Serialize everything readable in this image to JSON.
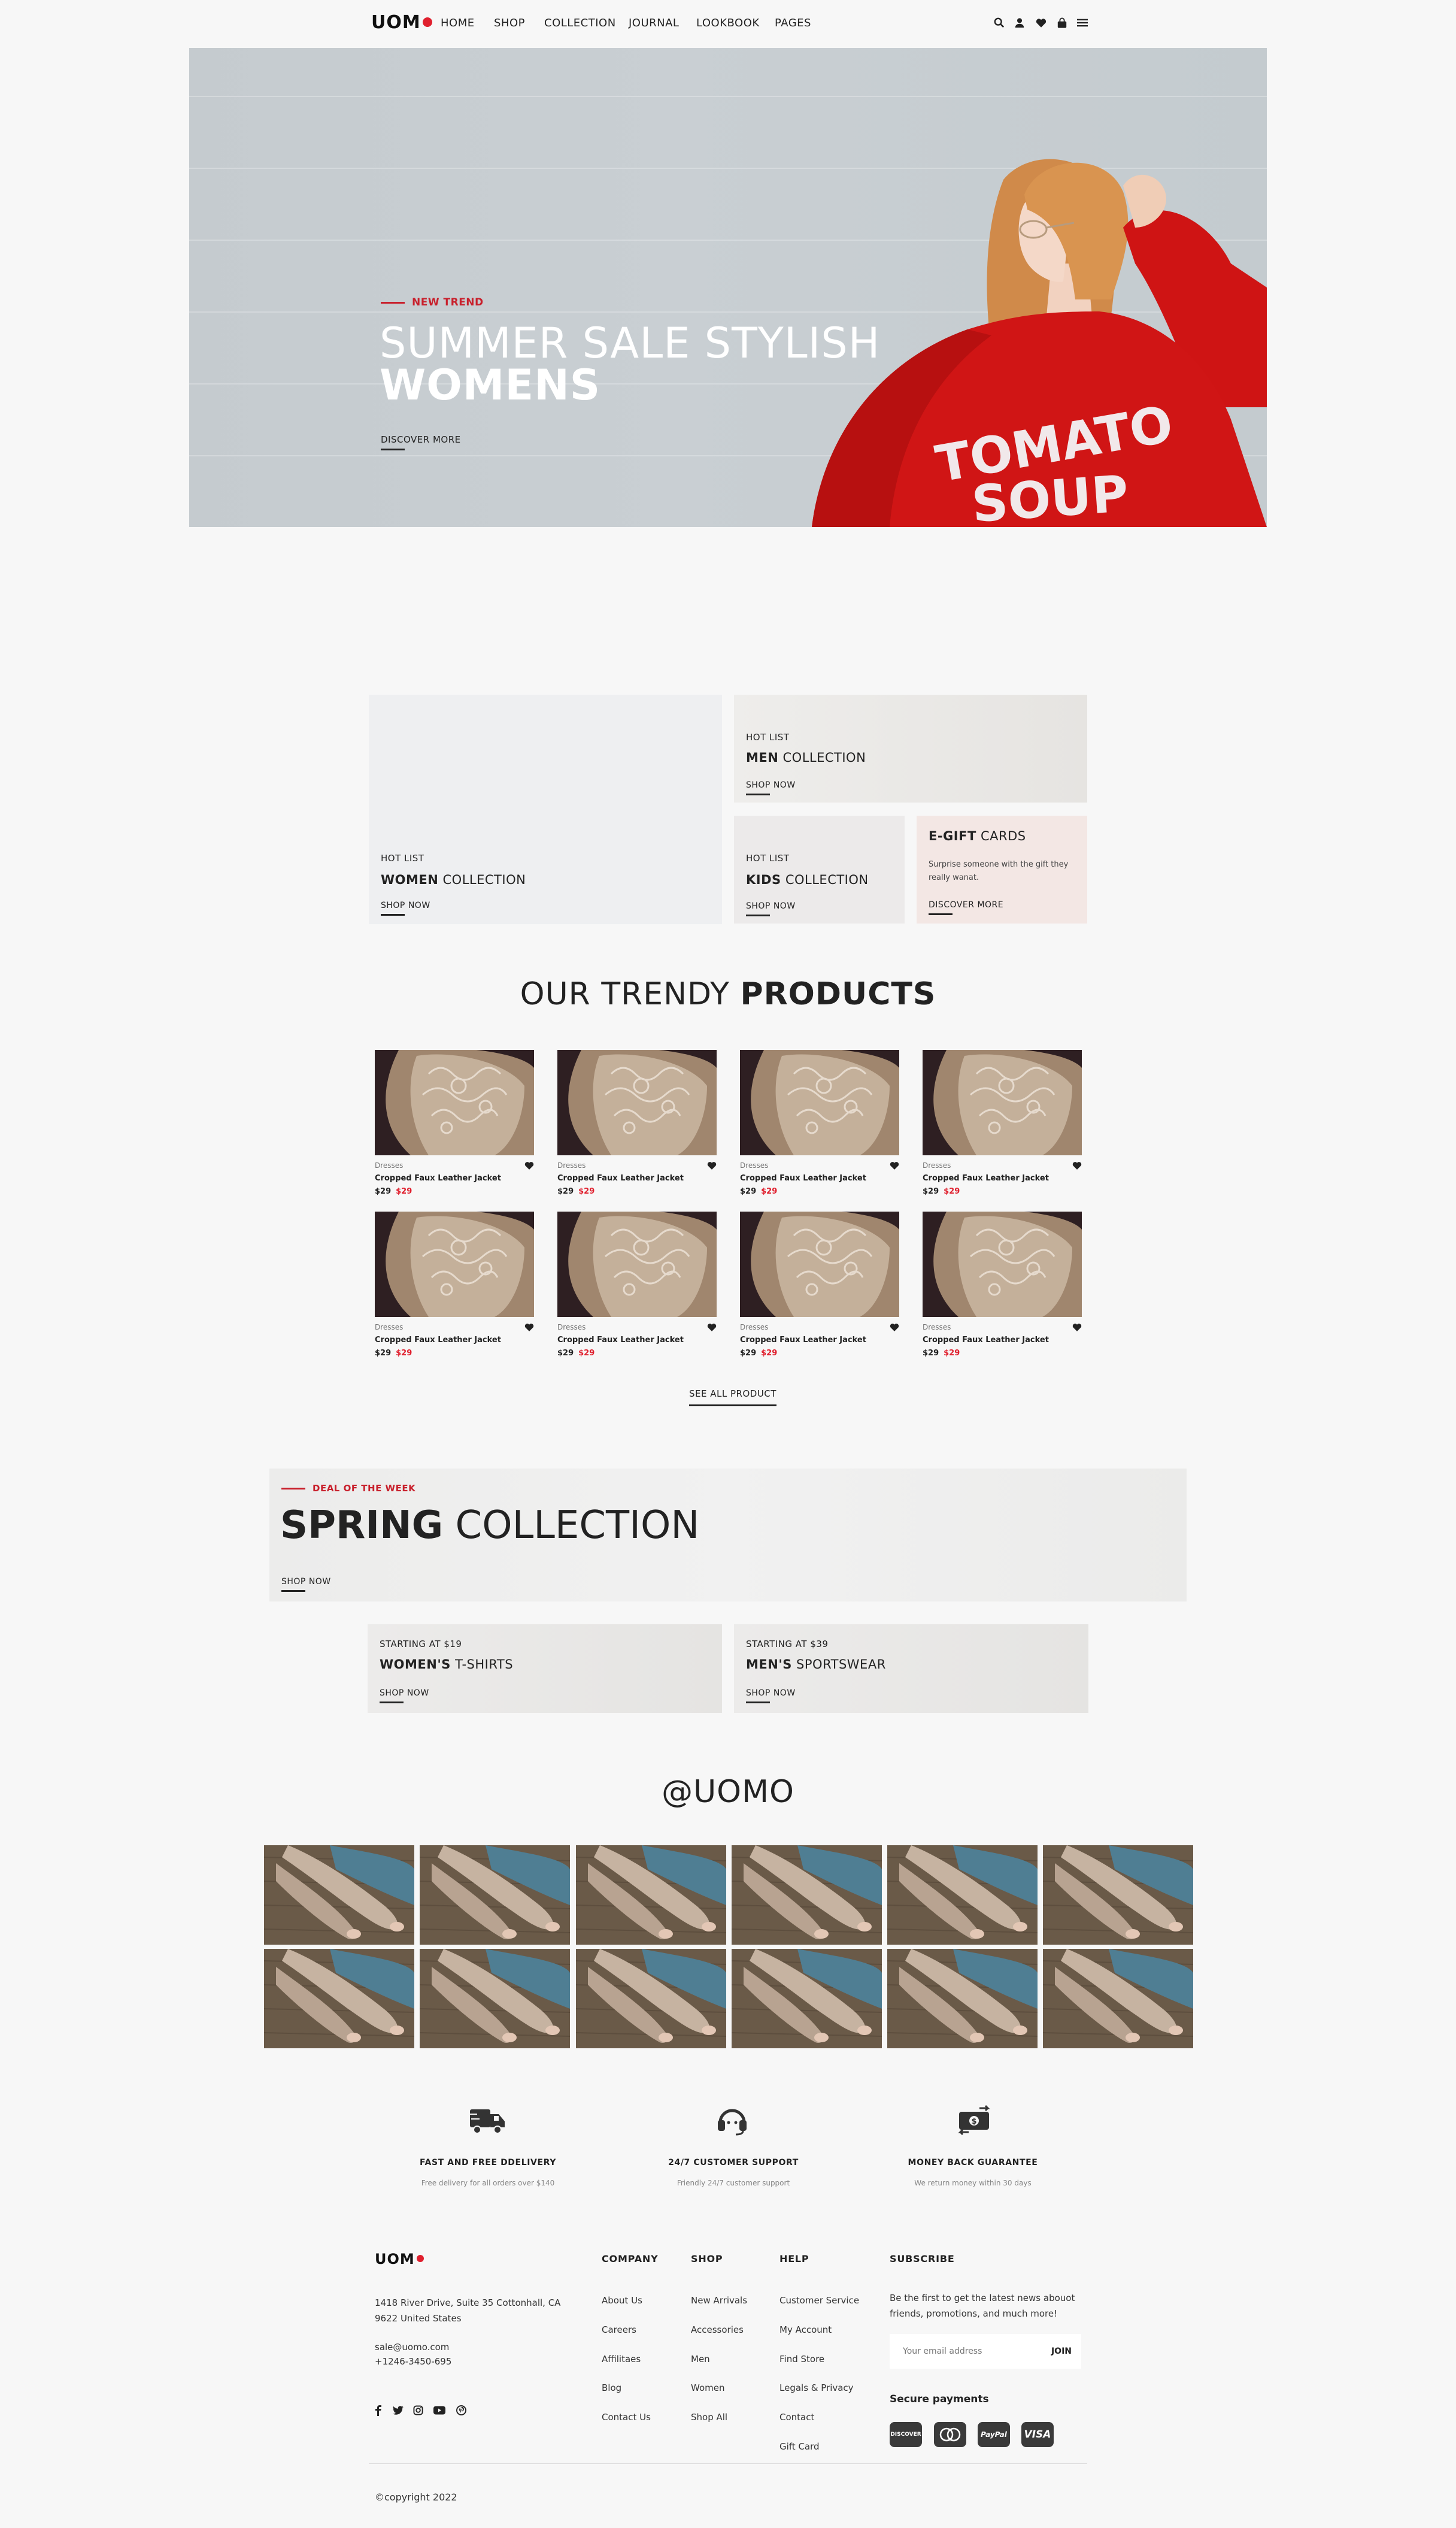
{
  "header": {
    "logo": "UOM",
    "nav": [
      "HOME",
      "SHOP",
      "COLLECTION",
      "JOURNAL",
      "LOOKBOOK",
      "PAGES"
    ],
    "icons": [
      "search-icon",
      "user-icon",
      "heart-icon",
      "cart-icon",
      "menu-icon"
    ]
  },
  "hero": {
    "tag": "NEW TREND",
    "title_light": "SUMMER SALE STYLISH",
    "title_bold": "WOMENS",
    "cta": "DISCOVER MORE",
    "shirt_text_1": "TOMATO",
    "shirt_text_2": "SOUP"
  },
  "collections": {
    "women": {
      "tag": "HOT LIST",
      "bold": "WOMEN",
      "rest": " COLLECTION",
      "cta": "SHOP NOW"
    },
    "men": {
      "tag": "HOT LIST",
      "bold": "MEN",
      "rest": " COLLECTION",
      "cta": "SHOP NOW"
    },
    "kids": {
      "tag": "HOT LIST",
      "bold": "KIDS",
      "rest": " COLLECTION",
      "cta": "SHOP NOW"
    },
    "gift": {
      "bold": "E-GIFT",
      "rest": " CARDS",
      "desc1": "Surprise someone with the gift they",
      "desc2": "really wanat.",
      "cta": "DISCOVER MORE"
    }
  },
  "products": {
    "title_light": "OUR TRENDY ",
    "title_bold": "PRODUCTS",
    "items": [
      {
        "category": "Dresses",
        "name": "Cropped Faux Leather Jacket",
        "price": "$29",
        "sale": "$29"
      },
      {
        "category": "Dresses",
        "name": "Cropped Faux Leather Jacket",
        "price": "$29",
        "sale": "$29"
      },
      {
        "category": "Dresses",
        "name": "Cropped Faux Leather Jacket",
        "price": "$29",
        "sale": "$29"
      },
      {
        "category": "Dresses",
        "name": "Cropped Faux Leather Jacket",
        "price": "$29",
        "sale": "$29"
      },
      {
        "category": "Dresses",
        "name": "Cropped Faux Leather Jacket",
        "price": "$29",
        "sale": "$29"
      },
      {
        "category": "Dresses",
        "name": "Cropped Faux Leather Jacket",
        "price": "$29",
        "sale": "$29"
      },
      {
        "category": "Dresses",
        "name": "Cropped Faux Leather Jacket",
        "price": "$29",
        "sale": "$29"
      },
      {
        "category": "Dresses",
        "name": "Cropped Faux Leather Jacket",
        "price": "$29",
        "sale": "$29"
      }
    ],
    "see_all": "SEE ALL PRODUCT"
  },
  "deal": {
    "tag": "DEAL OF THE WEEK",
    "title_bold": "SPRING",
    "title_light": " COLLECTION",
    "cta": "SHOP NOW"
  },
  "promo": {
    "women": {
      "tag": "STARTING AT $19",
      "bold": "WOMEN'S",
      "rest": " T-SHIRTS",
      "cta": "SHOP NOW"
    },
    "men": {
      "tag": "STARTING AT $39",
      "bold": "MEN'S",
      "rest": " SPORTSWEAR",
      "cta": "SHOP NOW"
    }
  },
  "instagram": {
    "title": "@UOMO"
  },
  "features": [
    {
      "icon": "truck-icon",
      "title": "FAST AND FREE DDELIVERY",
      "sub": "Free delivery for all orders over $140"
    },
    {
      "icon": "headset-icon",
      "title": "24/7 CUSTOMER SUPPORT",
      "sub": "Friendly 24/7 customer support"
    },
    {
      "icon": "money-exchange-icon",
      "title": "MONEY BACK GUARANTEE",
      "sub": "We return money within 30 days"
    }
  ],
  "footer": {
    "logo": "UOM",
    "address1": "1418 River Drive, Suite 35 Cottonhall, CA",
    "address2": "9622 United States",
    "email": "sale@uomo.com",
    "phone": "+1246-3450-695",
    "social": [
      "facebook-icon",
      "twitter-icon",
      "instagram-icon",
      "youtube-icon",
      "pinterest-icon"
    ],
    "company": {
      "title": "COMPANY",
      "links": [
        "About Us",
        "Careers",
        "Affilitaes",
        "Blog",
        "Contact Us"
      ]
    },
    "shop": {
      "title": "SHOP",
      "links": [
        "New Arrivals",
        "Accessories",
        "Men",
        "Women",
        "Shop All"
      ]
    },
    "help": {
      "title": "HELP",
      "links": [
        "Customer Service",
        "My Account",
        "Find Store",
        "Legals & Privacy",
        "Contact",
        "Gift Card"
      ]
    },
    "subscribe": {
      "title": "SUBSCRIBE",
      "desc1": "Be the first to get the latest news abouot",
      "desc2": "friends, promotions, and much more!",
      "placeholder": "Your email address",
      "join": "JOIN",
      "secure": "Secure payments",
      "payments": [
        "DISCOVER",
        "MASTERCARD",
        "PayPal",
        "VISA"
      ]
    },
    "copyright": "©copyright 2022"
  }
}
